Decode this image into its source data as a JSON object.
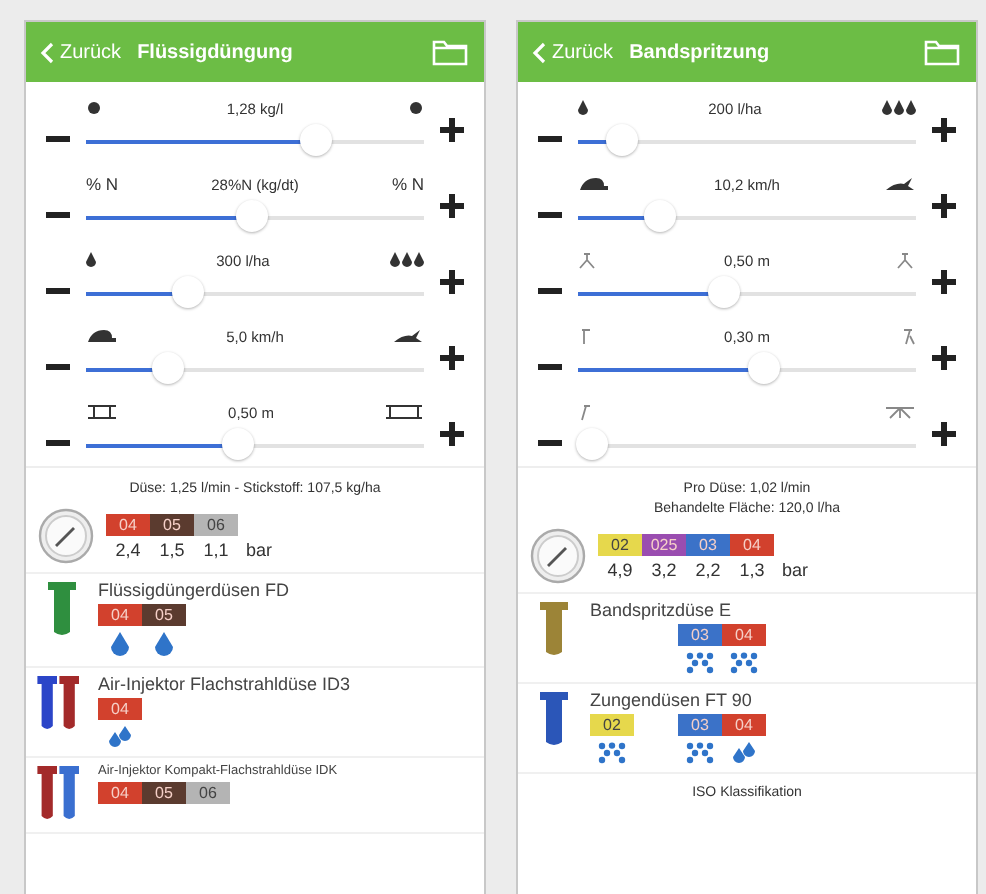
{
  "panels": [
    {
      "header": {
        "back": "Zurück",
        "title": "Flüssigdüngung"
      },
      "sliders": [
        {
          "kind": "density",
          "value": "1,28 kg/l",
          "level": 0.68
        },
        {
          "kind": "text",
          "min_label": "% N",
          "max_label": "% N",
          "value": "28%N (kg/dt)",
          "level": 0.49
        },
        {
          "kind": "rate",
          "value": "300 l/ha",
          "level": 0.3
        },
        {
          "kind": "speed",
          "value": "5,0 km/h",
          "level": 0.24
        },
        {
          "kind": "spacing",
          "value": "0,50 m",
          "level": 0.45
        }
      ],
      "info": [
        "Düse: 1,25 l/min - Stickstoff: 107,5 kg/ha"
      ],
      "pressure": {
        "tags": [
          {
            "label": "04",
            "color": "#d2412d"
          },
          {
            "label": "05",
            "color": "#5b3b2f"
          },
          {
            "label": "06",
            "color": "#b4b4b4"
          }
        ],
        "values": [
          "2,4",
          "1,5",
          "1,1"
        ],
        "unit": "bar"
      },
      "nozzles": [
        {
          "name": "Flüssigdüngerdüsen FD",
          "parts": [
            {
              "color": "#2f8f3f"
            }
          ],
          "tags": [
            {
              "kind": "drop",
              "label": "04",
              "color": "#d2412d"
            },
            {
              "kind": "drop",
              "label": "05",
              "color": "#5b3b2f"
            }
          ]
        },
        {
          "name": "Air-Injektor Flachstrahldüse ID3",
          "parts": [
            {
              "color": "#2b45c8"
            },
            {
              "color": "#a32a2a"
            }
          ],
          "tags": [
            {
              "kind": "pair",
              "label": "04",
              "color": "#d2412d"
            }
          ]
        },
        {
          "name": "Air-Injektor Kompakt-Flachstrahldüse IDK",
          "small": true,
          "parts": [
            {
              "color": "#a32a2a"
            },
            {
              "color": "#3a6fd0"
            }
          ],
          "tags": [
            {
              "kind": "plain",
              "label": "04",
              "color": "#d2412d"
            },
            {
              "kind": "plain",
              "label": "05",
              "color": "#5b3b2f"
            },
            {
              "kind": "plain",
              "label": "06",
              "color": "#b4b4b4"
            }
          ]
        }
      ]
    },
    {
      "header": {
        "back": "Zurück",
        "title": "Bandspritzung"
      },
      "sliders": [
        {
          "kind": "rate",
          "value": "200 l/ha",
          "level": 0.13
        },
        {
          "kind": "speed",
          "value": "10,2 km/h",
          "level": 0.24
        },
        {
          "kind": "height",
          "value": "0,50 m",
          "level": 0.43
        },
        {
          "kind": "band",
          "value": "0,30 m",
          "level": 0.55
        },
        {
          "kind": "angle",
          "level": 0.04
        }
      ],
      "info": [
        "Pro Düse: 1,02 l/min",
        "Behandelte Fläche: 120,0 l/ha"
      ],
      "pressure": {
        "tags": [
          {
            "label": "02",
            "color": "#e6d84c"
          },
          {
            "label": "025",
            "color": "#9a4db0"
          },
          {
            "label": "03",
            "color": "#3b72c8"
          },
          {
            "label": "04",
            "color": "#d2412d"
          }
        ],
        "values": [
          "4,9",
          "3,2",
          "2,2",
          "1,3"
        ],
        "unit": "bar"
      },
      "nozzles": [
        {
          "name": "Bandspritzdüse E",
          "parts": [
            {
              "color": "#9c8437"
            }
          ],
          "tags": [
            {
              "kind": "gap"
            },
            {
              "kind": "gap"
            },
            {
              "kind": "cluster",
              "label": "03",
              "color": "#3b72c8"
            },
            {
              "kind": "cluster",
              "label": "04",
              "color": "#d2412d"
            }
          ]
        },
        {
          "name": "Zungendüsen FT 90",
          "parts": [
            {
              "color": "#2b56b8"
            }
          ],
          "tags": [
            {
              "kind": "cluster",
              "label": "02",
              "color": "#e6d84c"
            },
            {
              "kind": "gap"
            },
            {
              "kind": "cluster",
              "label": "03",
              "color": "#3b72c8"
            },
            {
              "kind": "pair",
              "label": "04",
              "color": "#d2412d"
            }
          ]
        }
      ],
      "footer": "ISO Klassifikation"
    }
  ]
}
